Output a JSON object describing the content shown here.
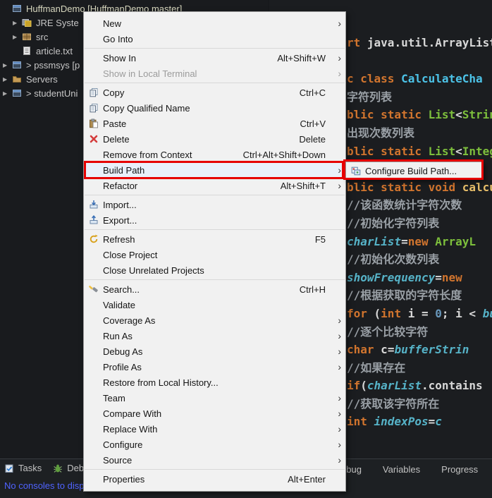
{
  "app": {
    "accent_red": "#e60000"
  },
  "sidebar": {
    "root": {
      "label": "HuffmanDemo [HuffmanDemo master]",
      "icon": "project"
    },
    "items": [
      {
        "label": "JRE Syste",
        "icon": "library",
        "arrow": true,
        "indent": 1
      },
      {
        "label": "src",
        "icon": "package",
        "arrow": true,
        "indent": 1
      },
      {
        "label": "article.txt",
        "icon": "file",
        "arrow": false,
        "indent": 1
      },
      {
        "label": "> pssmsys [p",
        "icon": "project",
        "arrow": true,
        "indent": 0
      },
      {
        "label": "Servers",
        "icon": "folder",
        "arrow": true,
        "indent": 0
      },
      {
        "label": "> studentUni",
        "icon": "project",
        "arrow": true,
        "indent": 0
      }
    ]
  },
  "menu": {
    "items": [
      {
        "label": "New",
        "submenu": true
      },
      {
        "label": "Go Into"
      },
      {
        "type": "separator"
      },
      {
        "label": "Show In",
        "shortcut": "Alt+Shift+W",
        "submenu": true
      },
      {
        "label": "Show in Local Terminal",
        "submenu": true,
        "disabled": true
      },
      {
        "type": "separator"
      },
      {
        "label": "Copy",
        "shortcut": "Ctrl+C",
        "icon": "copy"
      },
      {
        "label": "Copy Qualified Name",
        "icon": "copy"
      },
      {
        "label": "Paste",
        "shortcut": "Ctrl+V",
        "icon": "paste"
      },
      {
        "label": "Delete",
        "shortcut": "Delete",
        "icon": "delete"
      },
      {
        "label": "Remove from Context",
        "shortcut": "Ctrl+Alt+Shift+Down"
      },
      {
        "label": "Build Path",
        "submenu": true,
        "highlight": true
      },
      {
        "label": "Refactor",
        "shortcut": "Alt+Shift+T",
        "submenu": true
      },
      {
        "type": "separator"
      },
      {
        "label": "Import...",
        "icon": "import"
      },
      {
        "label": "Export...",
        "icon": "export"
      },
      {
        "type": "separator"
      },
      {
        "label": "Refresh",
        "shortcut": "F5",
        "icon": "refresh"
      },
      {
        "label": "Close Project"
      },
      {
        "label": "Close Unrelated Projects"
      },
      {
        "type": "separator"
      },
      {
        "label": "Search...",
        "shortcut": "Ctrl+H",
        "icon": "search"
      },
      {
        "label": "Validate"
      },
      {
        "label": "Coverage As",
        "submenu": true
      },
      {
        "label": "Run As",
        "submenu": true
      },
      {
        "label": "Debug As",
        "submenu": true
      },
      {
        "label": "Profile As",
        "submenu": true
      },
      {
        "label": "Restore from Local History..."
      },
      {
        "label": "Team",
        "submenu": true
      },
      {
        "label": "Compare With",
        "submenu": true
      },
      {
        "label": "Replace With",
        "submenu": true
      },
      {
        "label": "Configure",
        "submenu": true
      },
      {
        "label": "Source",
        "submenu": true
      },
      {
        "type": "separator"
      },
      {
        "label": "Properties",
        "shortcut": "Alt+Enter"
      }
    ]
  },
  "submenu": {
    "items": [
      {
        "label": "Configure Build Path...",
        "icon": "build-path"
      }
    ]
  },
  "editor": {
    "lines": [
      {
        "segments": [
          {
            "t": "rt ",
            "c": "kw"
          },
          {
            "t": "java.util.ArrayList;",
            "c": "plain"
          }
        ]
      },
      {
        "blank": true
      },
      {
        "segments": [
          {
            "t": "c class ",
            "c": "kw"
          },
          {
            "t": "CalculateCha",
            "c": "cls"
          }
        ]
      },
      {
        "segments": [
          {
            "t": "字符列表",
            "c": "cmt"
          }
        ]
      },
      {
        "segments": [
          {
            "t": "blic static ",
            "c": "kw"
          },
          {
            "t": "List",
            "c": "type"
          },
          {
            "t": "<",
            "c": "plain"
          },
          {
            "t": "String",
            "c": "type"
          }
        ]
      },
      {
        "segments": [
          {
            "t": "出现次数列表",
            "c": "cmt"
          }
        ]
      },
      {
        "segments": [
          {
            "t": "blic static ",
            "c": "kw"
          },
          {
            "t": "List",
            "c": "type"
          },
          {
            "t": "<",
            "c": "plain"
          },
          {
            "t": "Integ",
            "c": "type"
          }
        ]
      },
      {
        "blank": true
      },
      {
        "segments": [
          {
            "t": "blic static void ",
            "c": "kw"
          },
          {
            "t": "calcu",
            "c": "meth"
          }
        ]
      },
      {
        "segments": [
          {
            "t": "//该函数统计字符次数",
            "c": "cmt"
          }
        ]
      },
      {
        "segments": [
          {
            "t": "//初始化字符列表",
            "c": "cmt"
          }
        ]
      },
      {
        "segments": [
          {
            "t": "charList",
            "c": "var"
          },
          {
            "t": "=",
            "c": "plain"
          },
          {
            "t": "new ",
            "c": "kw"
          },
          {
            "t": "ArrayL",
            "c": "type"
          }
        ]
      },
      {
        "segments": [
          {
            "t": "//初始化次数列表",
            "c": "cmt"
          }
        ]
      },
      {
        "segments": [
          {
            "t": "showFrequency",
            "c": "var"
          },
          {
            "t": "=",
            "c": "plain"
          },
          {
            "t": "new",
            "c": "kw"
          }
        ]
      },
      {
        "segments": [
          {
            "t": "//根据获取的字符长度",
            "c": "cmt"
          }
        ]
      },
      {
        "segments": [
          {
            "t": "for ",
            "c": "kw"
          },
          {
            "t": "(",
            "c": "plain"
          },
          {
            "t": "int ",
            "c": "kw"
          },
          {
            "t": "i = ",
            "c": "plain"
          },
          {
            "t": "0",
            "c": "num"
          },
          {
            "t": "; i < ",
            "c": "plain"
          },
          {
            "t": "buff",
            "c": "var"
          }
        ]
      },
      {
        "segments": [
          {
            "t": "//逐个比较字符",
            "c": "cmt"
          }
        ]
      },
      {
        "segments": [
          {
            "t": "char ",
            "c": "kw"
          },
          {
            "t": "c",
            "c": "plain"
          },
          {
            "t": "=",
            "c": "plain"
          },
          {
            "t": "bufferStrin",
            "c": "var"
          }
        ]
      },
      {
        "segments": [
          {
            "t": "//如果存在",
            "c": "cmt"
          }
        ]
      },
      {
        "segments": [
          {
            "t": "if",
            "c": "kw"
          },
          {
            "t": "(",
            "c": "plain"
          },
          {
            "t": "charList",
            "c": "var"
          },
          {
            "t": ".contains",
            "c": "plain"
          }
        ]
      },
      {
        "segments": [
          {
            "t": "//获取该字符所在",
            "c": "cmt"
          }
        ]
      },
      {
        "segments": [
          {
            "t": "int ",
            "c": "kw"
          },
          {
            "t": "indexPos",
            "c": "var"
          },
          {
            "t": "=",
            "c": "plain"
          },
          {
            "t": "c",
            "c": "var"
          }
        ]
      }
    ]
  },
  "bottom": {
    "left_tabs": [
      {
        "label": "Tasks",
        "icon": "tasks"
      },
      {
        "label": "Debug",
        "icon": "debug"
      }
    ],
    "console_message": "No consoles to disp",
    "right_tabs": [
      "ebug",
      "Variables",
      "Progress"
    ]
  }
}
